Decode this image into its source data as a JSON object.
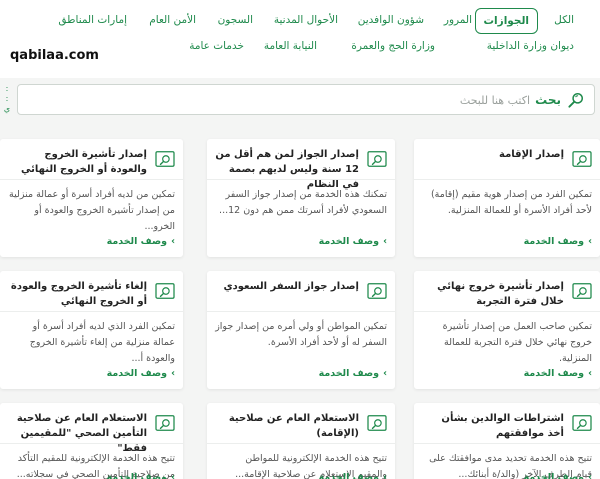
{
  "site_name": "qabilaa.com",
  "filters": {
    "row1": [
      "الكل",
      "الجوازات",
      "المرور",
      "شؤون الوافدين",
      "الأحوال المدنية",
      "السجون",
      "الأمن العام",
      "إمارات المناطق"
    ],
    "row2": [
      "ديوان وزارة الداخلية",
      "وزارة الحج والعمرة",
      "النيابة العامة",
      "خدمات عامة"
    ]
  },
  "search": {
    "button_label": "بحث",
    "placeholder": "اكتب هنا للبحث"
  },
  "colors": {
    "accent": "#1f8a4c",
    "background": "#f4f5f4",
    "card": "#ffffff"
  },
  "cards": [
    {
      "title": "إصدار الإقامة",
      "desc": "تمكين الفرد من إصدار هوية مقيم (إقامة) لأحد أفراد الأسرة أو للعمالة المنزلية.",
      "link": "وصف الخدمة"
    },
    {
      "title": "إصدار الجواز لمن هم أقل من 12 سنة وليس لديهم بصمة في النظام",
      "desc": "تمكنك هذه الخدمة من إصدار جواز السفر السعودي لأفراد أسرتك ممن هم دون 12...",
      "link": "وصف الخدمة"
    },
    {
      "title": "إصدار تأشيرة الخروج والعودة أو الخروج النهائي",
      "desc": "تمكين من لديه أفراد أسرة أو عمالة منزلية من إصدار تأشيرة الخروج والعودة أو الخرو...",
      "link": "وصف الخدمة"
    },
    {
      "title": "إصدار تأشيرة خروج نهائي خلال فترة التجربة",
      "desc": "تمكين صاحب العمل من إصدار تأشيرة خروج نهائي خلال فترة التجربة للعمالة المنزلية.",
      "link": "وصف الخدمة"
    },
    {
      "title": "إصدار جواز السفر السعودي",
      "desc": "تمكين المواطن أو ولي أمره من إصدار جواز السفر له أو لأحد أفراد الأسرة.",
      "link": "وصف الخدمة"
    },
    {
      "title": "إلغاء تأشيرة الخروج والعودة أو الخروج النهائي",
      "desc": "تمكين الفرد الذي لديه أفراد أسرة أو عمالة منزلية من إلغاء تأشيرة الخروج والعودة أ...",
      "link": "وصف الخدمة"
    },
    {
      "title": "اشتراطات الوالدين بشأن أخذ موافقتهم",
      "desc": "تتيح هذه الخدمة تحديد مدى موافقتك على قيام الطرف الآخر (والد/ة أبنائك...",
      "link": "وصف الخدمة"
    },
    {
      "title": "الاستعلام العام عن صلاحية (الإقامة)",
      "desc": "تتيح هذه الخدمة الإلكترونية للمواطن والمقيم الاستعلام عن صلاحية الإقامة...",
      "link": "وصف الخدمة"
    },
    {
      "title": "الاستعلام العام عن صلاحية التأمين الصحي \"للمقيمين فقط\"",
      "desc": "تتيح هذه الخدمة الإلكترونية للمقيم التأكد من صلاحية التأمين الصحي في سجلاته...",
      "link": "وصف الخدمة"
    }
  ]
}
